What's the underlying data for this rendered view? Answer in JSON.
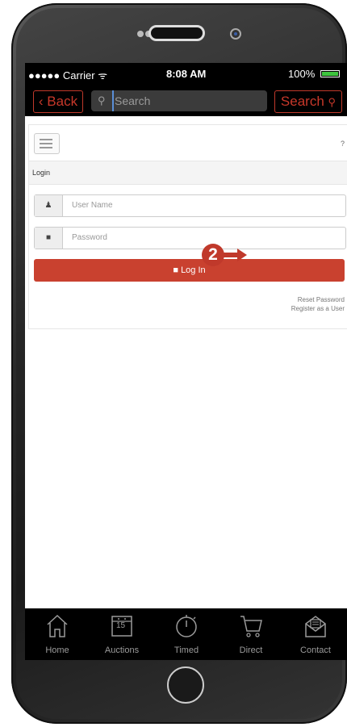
{
  "status_bar": {
    "carrier": "●●●●● Carrier ᯤ",
    "time": "8:08 AM",
    "battery": "100%"
  },
  "nav": {
    "back_label": "‹ Back",
    "search_placeholder": "Search",
    "search_button_label": "Search"
  },
  "page": {
    "help_icon": "?",
    "section_title": "Login",
    "username_placeholder": "User Name",
    "password_placeholder": "Password",
    "login_button_label": "Log In",
    "reset_password_link": "Reset Password",
    "register_link": "Register as a User"
  },
  "callout": {
    "number": "2"
  },
  "tabs": [
    {
      "label": "Home",
      "icon": "home-icon"
    },
    {
      "label": "Auctions",
      "icon": "calendar-icon",
      "badge": "15"
    },
    {
      "label": "Timed",
      "icon": "stopwatch-icon"
    },
    {
      "label": "Direct",
      "icon": "cart-icon"
    },
    {
      "label": "Contact",
      "icon": "envelope-icon"
    }
  ],
  "colors": {
    "accent": "#c9412f",
    "navbar": "#000000",
    "tab_text": "#9b9b9b"
  }
}
